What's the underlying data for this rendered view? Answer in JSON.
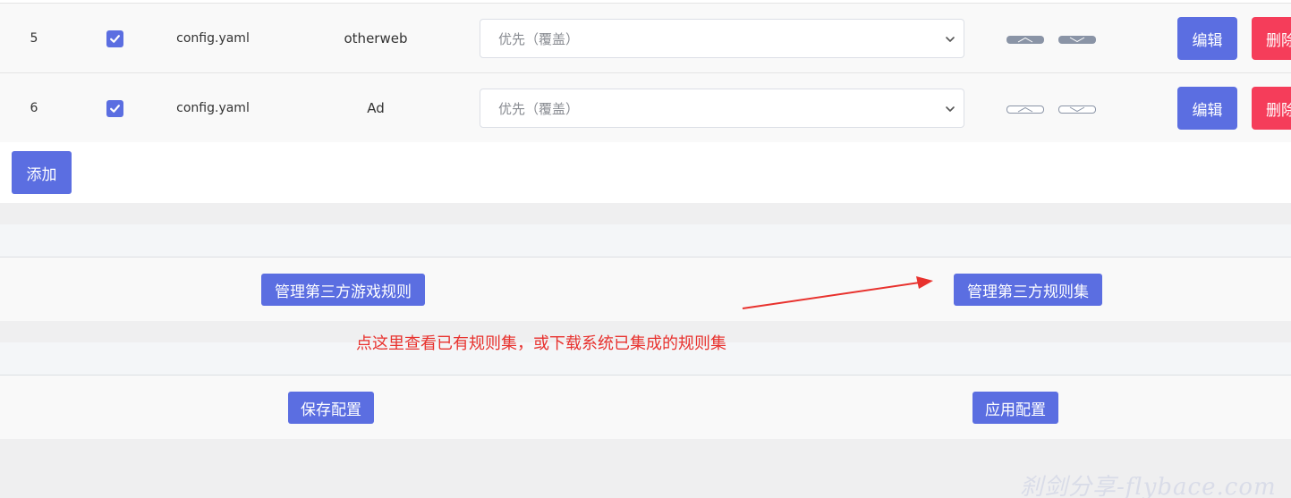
{
  "rules_table": {
    "rows": [
      {
        "index": "5",
        "checked": true,
        "file": "config.yaml",
        "name": "otherweb",
        "priority": "优先（覆盖）",
        "edit_label": "编辑",
        "delete_label": "删除"
      },
      {
        "index": "6",
        "checked": true,
        "file": "config.yaml",
        "name": "Ad",
        "priority": "优先（覆盖）",
        "edit_label": "编辑",
        "delete_label": "删除"
      }
    ],
    "add_label": "添加"
  },
  "third_party": {
    "game_rules_label": "管理第三方游戏规则",
    "rulesets_label": "管理第三方规则集"
  },
  "annotation": {
    "text": "点这里查看已有规则集，或下载系统已集成的规则集",
    "color": "#e8322e"
  },
  "config_actions": {
    "save_label": "保存配置",
    "apply_label": "应用配置"
  },
  "watermark": {
    "text": "刹剑分享-flybace.com"
  },
  "colors": {
    "primary": "#5b6ee1",
    "danger": "#f53d5a"
  }
}
